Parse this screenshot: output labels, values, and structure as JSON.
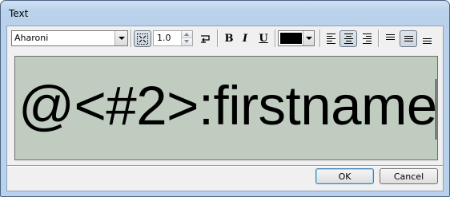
{
  "window": {
    "title": "Text"
  },
  "toolbar": {
    "font_name": "Aharoni",
    "size_value": "1.0",
    "bold_label": "B",
    "italic_label": "I",
    "underline_label": "U",
    "text_color": "#000000"
  },
  "editor": {
    "text": "@<#2>:firstname",
    "background": "#c0ccc0"
  },
  "buttons": {
    "ok": "OK",
    "cancel": "Cancel"
  }
}
